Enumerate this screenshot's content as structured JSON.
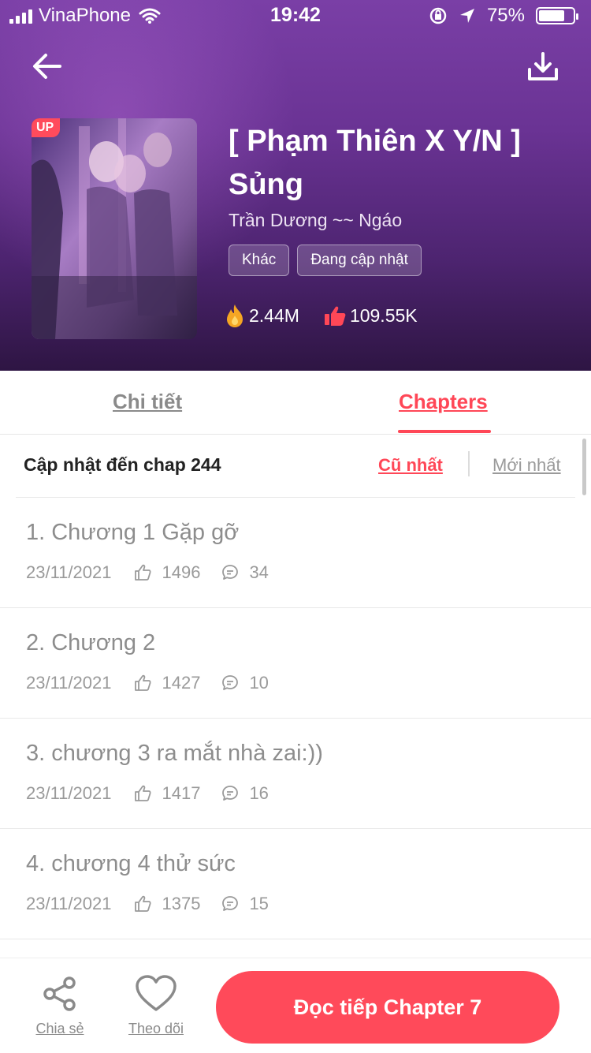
{
  "status_bar": {
    "carrier": "VinaPhone",
    "time": "19:42",
    "battery": "75%",
    "battery_level": 0.75
  },
  "comic": {
    "badge": "UP",
    "title": "[ Phạm Thiên X Y/N ] Sủng",
    "author": "Trần Dương ~~ Ngáo",
    "tags": [
      "Khác",
      "Đang cập nhật"
    ],
    "views": "2.44M",
    "likes": "109.55K"
  },
  "tabs": {
    "detail": "Chi tiết",
    "chapters": "Chapters"
  },
  "chapter_list": {
    "update_label": "Cập nhật đến chap 244",
    "sort_oldest": "Cũ nhất",
    "sort_newest": "Mới nhất",
    "items": [
      {
        "title": "1. Chương 1 Gặp gỡ",
        "date": "23/11/2021",
        "likes": "1496",
        "comments": "34"
      },
      {
        "title": "2. Chương 2",
        "date": "23/11/2021",
        "likes": "1427",
        "comments": "10"
      },
      {
        "title": "3. chương 3 ra mắt nhà zai:))",
        "date": "23/11/2021",
        "likes": "1417",
        "comments": "16"
      },
      {
        "title": "4. chương 4 thử sức",
        "date": "23/11/2021",
        "likes": "1375",
        "comments": "15"
      }
    ]
  },
  "bottom_bar": {
    "share": "Chia sẻ",
    "follow": "Theo dõi",
    "read_continue": "Đọc tiếp Chapter 7"
  },
  "colors": {
    "accent": "#ff4757",
    "header_top": "#7a3fa6",
    "header_bottom": "#2e1543"
  },
  "icons": {
    "back": "arrow-left-icon",
    "download": "download-icon",
    "views": "fire-icon",
    "likes": "thumbs-up-icon",
    "chapter_like": "thumbs-up-outline-icon",
    "chapter_comment": "comment-icon",
    "share": "share-icon",
    "follow": "heart-icon"
  }
}
